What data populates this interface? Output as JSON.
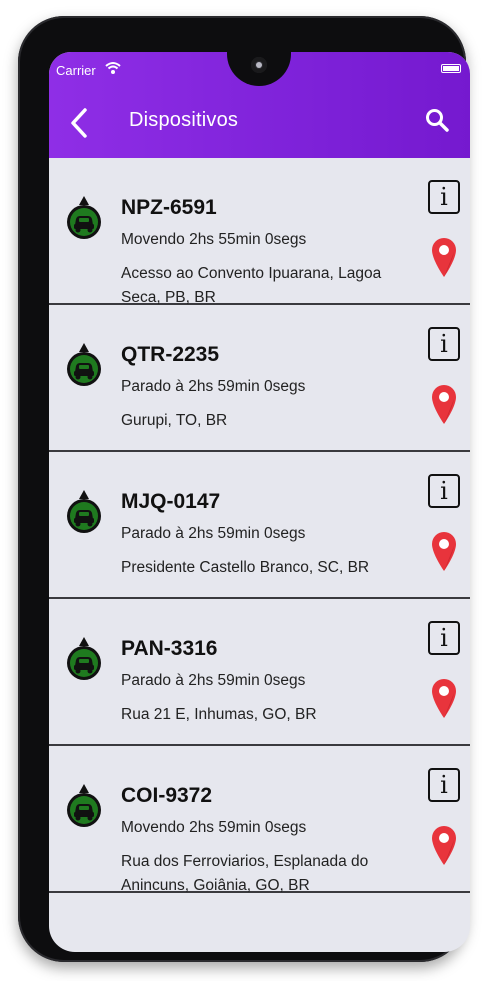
{
  "status_bar": {
    "carrier": "Carrier"
  },
  "header": {
    "title": "Dispositivos",
    "accent_color": "#7e22d9"
  },
  "devices": [
    {
      "plate": "NPZ-6591",
      "status": "Movendo 2hs 55min 0segs",
      "address": "Acesso ao Convento Ipuarana, Lagoa Seca, PB, BR"
    },
    {
      "plate": "QTR-2235",
      "status": "Parado à 2hs 59min 0segs",
      "address": "Gurupi, TO, BR"
    },
    {
      "plate": "MJQ-0147",
      "status": "Parado à 2hs 59min 0segs",
      "address": "Presidente Castello Branco, SC, BR"
    },
    {
      "plate": "PAN-3316",
      "status": "Parado à 2hs 59min 0segs",
      "address": "Rua 21 E, Inhumas, GO, BR"
    },
    {
      "plate": "COI-9372",
      "status": "Movendo 2hs 59min 0segs",
      "address": "Rua dos Ferroviarios, Esplanada do Anincuns, Goiânia, GO, BR"
    }
  ],
  "icons": {
    "back": "chevron-left-icon",
    "search": "search-icon",
    "vehicle": "car-icon",
    "info": "info-icon",
    "location": "map-pin-icon"
  },
  "labels": {
    "info_glyph": "i"
  }
}
